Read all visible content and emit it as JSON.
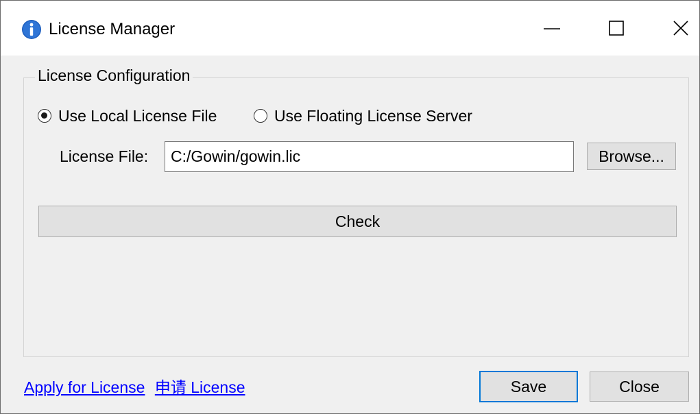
{
  "window": {
    "title": "License Manager",
    "app_icon": "info-icon",
    "controls": [
      "minimize-icon",
      "maximize-icon",
      "close-icon"
    ]
  },
  "group": {
    "legend": "License Configuration",
    "radio_local_label": "Use Local License File",
    "radio_local_selected": true,
    "radio_floating_label": "Use Floating License Server",
    "radio_floating_selected": false,
    "file_label": "License File:",
    "file_value": "C:/Gowin/gowin.lic",
    "browse_label": "Browse...",
    "check_label": "Check"
  },
  "footer": {
    "apply_link": "Apply for License",
    "apply_link_cn": "申请 License",
    "save_label": "Save",
    "close_label": "Close"
  },
  "colors": {
    "accent": "#0078d7",
    "link": "#0000ff",
    "info_icon": "#1e5fbf"
  }
}
